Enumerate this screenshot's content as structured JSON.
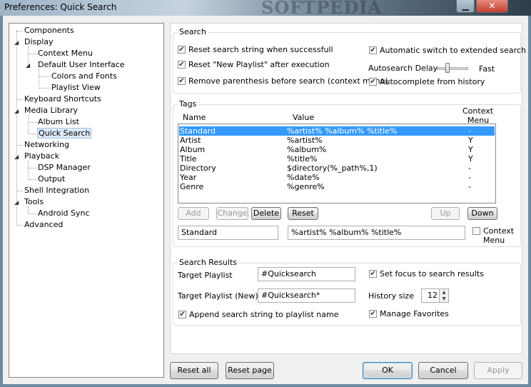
{
  "window": {
    "title": "Preferences: Quick Search",
    "watermark": "SOFTPEDIA"
  },
  "tree": [
    {
      "label": "Components"
    },
    {
      "label": "Display"
    },
    {
      "label": "Context Menu"
    },
    {
      "label": "Default User Interface"
    },
    {
      "label": "Colors and Fonts"
    },
    {
      "label": "Playlist View"
    },
    {
      "label": "Keyboard Shortcuts"
    },
    {
      "label": "Media Library"
    },
    {
      "label": "Album List"
    },
    {
      "label": "Quick Search"
    },
    {
      "label": "Networking"
    },
    {
      "label": "Playback"
    },
    {
      "label": "DSP Manager"
    },
    {
      "label": "Output"
    },
    {
      "label": "Shell Integration"
    },
    {
      "label": "Tools"
    },
    {
      "label": "Android Sync"
    },
    {
      "label": "Advanced"
    }
  ],
  "search": {
    "group_title": "Search",
    "reset_search": {
      "label": "Reset search string when successfull",
      "checked": true
    },
    "reset_new_playlist": {
      "label": "Reset \"New Playlist\" after execution",
      "checked": true
    },
    "remove_parenthesis": {
      "label": "Remove parenthesis before search (context menu)",
      "checked": true
    },
    "auto_switch": {
      "label": "Automatic switch to extended search",
      "checked": true
    },
    "autosearch_delay_label": "Autosearch Delay",
    "autosearch_delay_value": "Fast",
    "autocomplete": {
      "label": "Autocomplete from history",
      "checked": true
    }
  },
  "tags": {
    "group_title": "Tags",
    "columns": {
      "name": "Name",
      "value": "Value",
      "context1": "Context",
      "context2": "Menu"
    },
    "rows": [
      {
        "name": "Standard",
        "value": "%artist% %album% %title%",
        "ctx": "-",
        "selected": true
      },
      {
        "name": "Artist",
        "value": "%artist%",
        "ctx": "Y"
      },
      {
        "name": "Album",
        "value": "%album%",
        "ctx": "Y"
      },
      {
        "name": "Title",
        "value": "%title%",
        "ctx": "Y"
      },
      {
        "name": "Directory",
        "value": "$directory(%_path%,1)",
        "ctx": "-"
      },
      {
        "name": "Year",
        "value": "%date%",
        "ctx": "-"
      },
      {
        "name": "Genre",
        "value": "%genre%",
        "ctx": "-"
      }
    ],
    "buttons": {
      "add": "Add",
      "change": "Change",
      "delete": "Delete",
      "reset": "Reset",
      "up": "Up",
      "down": "Down"
    },
    "edit_name": "Standard",
    "edit_value": "%artist% %album% %title%",
    "context_menu_label1": "Context",
    "context_menu_label2": "Menu",
    "context_menu_checked": false
  },
  "results": {
    "group_title": "Search Results",
    "target_playlist_label": "Target Playlist",
    "target_playlist_value": "#Quicksearch",
    "target_playlist_new_label": "Target Playlist (New)",
    "target_playlist_new_value": "#Quicksearch*",
    "append": {
      "label": "Append search string to playlist name",
      "checked": true
    },
    "set_focus": {
      "label": "Set focus to search results",
      "checked": true
    },
    "history_size_label": "History size",
    "history_size_value": "12",
    "manage_favorites": {
      "label": "Manage Favorites",
      "checked": true
    }
  },
  "footer": {
    "reset_all": "Reset all",
    "reset_page": "Reset page",
    "ok": "OK",
    "cancel": "Cancel",
    "apply": "Apply"
  }
}
